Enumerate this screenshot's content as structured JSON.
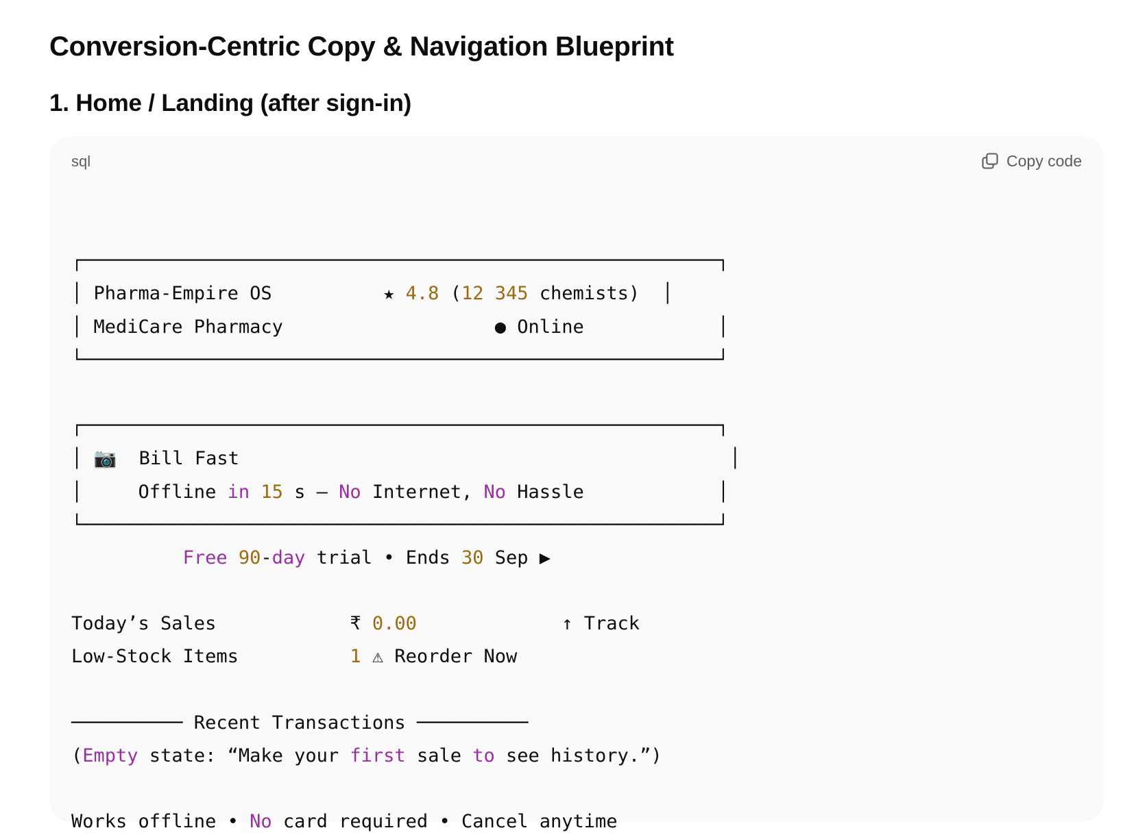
{
  "document": {
    "title": "Conversion-Centric Copy & Navigation Blueprint",
    "section_heading": "1. Home / Landing (after sign-in)"
  },
  "code_block": {
    "language": "sql",
    "copy_label": "Copy code",
    "lines": [
      {
        "tokens": [
          {
            "t": ""
          }
        ]
      },
      {
        "tokens": [
          {
            "t": "┌─────────────────────────────────────────────────────────┐"
          }
        ]
      },
      {
        "tokens": [
          {
            "t": "│ Pharma-Empire OS          ★ "
          },
          {
            "t": "4.8",
            "c": "num"
          },
          {
            "t": " ("
          },
          {
            "t": "12",
            "c": "num"
          },
          {
            "t": " "
          },
          {
            "t": "345",
            "c": "num"
          },
          {
            "t": " chemists)  │"
          }
        ]
      },
      {
        "tokens": [
          {
            "t": "│ MediCare Pharmacy                   ● Online            │"
          }
        ]
      },
      {
        "tokens": [
          {
            "t": "└─────────────────────────────────────────────────────────┘"
          }
        ]
      },
      {
        "tokens": [
          {
            "t": ""
          }
        ]
      },
      {
        "tokens": [
          {
            "t": "┌─────────────────────────────────────────────────────────┐"
          }
        ]
      },
      {
        "tokens": [
          {
            "t": "│ 📷  Bill Fast                                            │"
          }
        ]
      },
      {
        "tokens": [
          {
            "t": "│     Offline "
          },
          {
            "t": "in",
            "c": "kw"
          },
          {
            "t": " "
          },
          {
            "t": "15",
            "c": "num"
          },
          {
            "t": " s – "
          },
          {
            "t": "No",
            "c": "kw"
          },
          {
            "t": " Internet, "
          },
          {
            "t": "No",
            "c": "kw"
          },
          {
            "t": " Hassle            │"
          }
        ]
      },
      {
        "tokens": [
          {
            "t": "└─────────────────────────────────────────────────────────┘"
          }
        ]
      },
      {
        "tokens": [
          {
            "t": "          "
          },
          {
            "t": "Free",
            "c": "kw"
          },
          {
            "t": " "
          },
          {
            "t": "90",
            "c": "num"
          },
          {
            "t": "-"
          },
          {
            "t": "day",
            "c": "kw"
          },
          {
            "t": " trial • Ends "
          },
          {
            "t": "30",
            "c": "num"
          },
          {
            "t": " Sep ▶"
          }
        ]
      },
      {
        "tokens": [
          {
            "t": ""
          }
        ]
      },
      {
        "tokens": [
          {
            "t": "Today’s Sales            ₹ "
          },
          {
            "t": "0.00",
            "c": "num"
          },
          {
            "t": "             ↑ Track"
          }
        ]
      },
      {
        "tokens": [
          {
            "t": "Low-Stock Items          "
          },
          {
            "t": "1",
            "c": "num"
          },
          {
            "t": " ⚠ Reorder Now"
          }
        ]
      },
      {
        "tokens": [
          {
            "t": ""
          }
        ]
      },
      {
        "tokens": [
          {
            "t": "────────── Recent Transactions ──────────"
          }
        ]
      },
      {
        "tokens": [
          {
            "t": "("
          },
          {
            "t": "Empty",
            "c": "kw"
          },
          {
            "t": " state: “Make your "
          },
          {
            "t": "first",
            "c": "kw"
          },
          {
            "t": " sale "
          },
          {
            "t": "to",
            "c": "kw"
          },
          {
            "t": " see history.”)"
          }
        ]
      },
      {
        "tokens": [
          {
            "t": ""
          }
        ]
      },
      {
        "tokens": [
          {
            "t": "Works offline • "
          },
          {
            "t": "No",
            "c": "kw"
          },
          {
            "t": " card required • Cancel anytime"
          }
        ]
      }
    ]
  }
}
